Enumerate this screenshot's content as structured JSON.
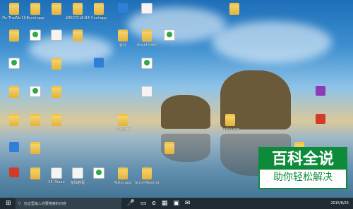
{
  "desktop": {
    "icons": [
      {
        "label": "Fix TheWin10",
        "type": "folder"
      },
      {
        "label": "Bysvt.app",
        "type": "folder"
      },
      {
        "label": "",
        "type": "folder"
      },
      {
        "label": "$RECYCLE.BIN",
        "type": "folder"
      },
      {
        "label": "Cnchapp",
        "type": "folder"
      },
      {
        "label": "",
        "type": "app"
      },
      {
        "label": "",
        "type": "doc"
      },
      {
        "label": "",
        "type": "folder"
      },
      {
        "label": "",
        "type": "folder"
      },
      {
        "label": "",
        "type": "video"
      },
      {
        "label": "",
        "type": "doc"
      },
      {
        "label": "",
        "type": "folder"
      },
      {
        "label": "软件",
        "type": "folder"
      },
      {
        "label": "skygrlmsler",
        "type": "folder"
      },
      {
        "label": "",
        "type": "video"
      },
      {
        "label": "",
        "type": "video"
      },
      {
        "label": "",
        "type": "folder"
      },
      {
        "label": "",
        "type": "app"
      },
      {
        "label": "",
        "type": "video"
      },
      {
        "label": "",
        "type": "folder"
      },
      {
        "label": "",
        "type": "video"
      },
      {
        "label": "",
        "type": "folder"
      },
      {
        "label": "",
        "type": "doc"
      },
      {
        "label": "",
        "type": "purple"
      },
      {
        "label": "",
        "type": "folder"
      },
      {
        "label": "",
        "type": "folder"
      },
      {
        "label": "",
        "type": "folder"
      },
      {
        "label": "",
        "type": "pdf"
      },
      {
        "label": "Reckerfir",
        "type": "folder"
      },
      {
        "label": "Rxsiyy.exe",
        "type": "folder"
      },
      {
        "label": "",
        "type": "app"
      },
      {
        "label": "",
        "type": "folder"
      },
      {
        "label": "",
        "type": "folder"
      },
      {
        "label": "教程",
        "type": "folder"
      },
      {
        "label": "",
        "type": "pdf"
      },
      {
        "label": "",
        "type": "folder"
      },
      {
        "label": "25_Stone",
        "type": "doc"
      },
      {
        "label": "基础教程",
        "type": "doc"
      },
      {
        "label": "",
        "type": "video"
      },
      {
        "label": "Tatter.app",
        "type": "folder"
      },
      {
        "label": "Scroll Reverser.app",
        "type": "folder"
      }
    ],
    "watermark": {
      "top": "百科全说",
      "bottom": "助你轻松解决"
    }
  },
  "taskbar": {
    "search_placeholder": "在这里输入你要搜索的内容",
    "clock": "2015/8/25"
  }
}
